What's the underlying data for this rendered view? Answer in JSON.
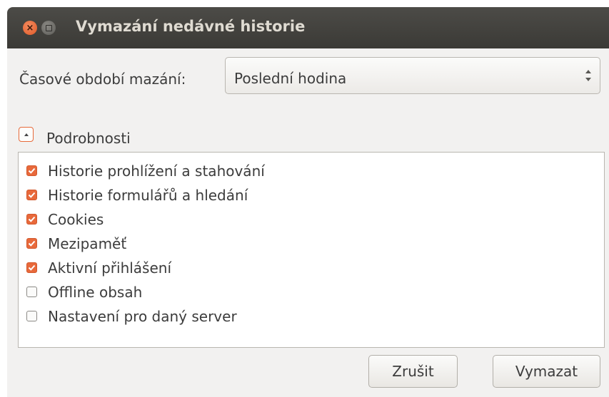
{
  "window": {
    "title": "Vymazání nedávné historie",
    "close_glyph": "×"
  },
  "period": {
    "label": "Časové období mazání:",
    "selected": "Poslední hodina"
  },
  "details": {
    "label": "Podrobnosti",
    "expanded": true
  },
  "items": [
    {
      "label": "Historie prohlížení a stahování",
      "checked": true
    },
    {
      "label": "Historie formulářů a hledání",
      "checked": true
    },
    {
      "label": "Cookies",
      "checked": true
    },
    {
      "label": "Mezipaměť",
      "checked": true
    },
    {
      "label": "Aktivní přihlášení",
      "checked": true
    },
    {
      "label": "Offline obsah",
      "checked": false
    },
    {
      "label": "Nastavení pro daný server",
      "checked": false
    }
  ],
  "buttons": {
    "cancel": "Zrušit",
    "clear": "Vymazat"
  },
  "colors": {
    "accent": "#e8693b",
    "titlebar": "#3b3a36",
    "background": "#f2f1f0"
  }
}
